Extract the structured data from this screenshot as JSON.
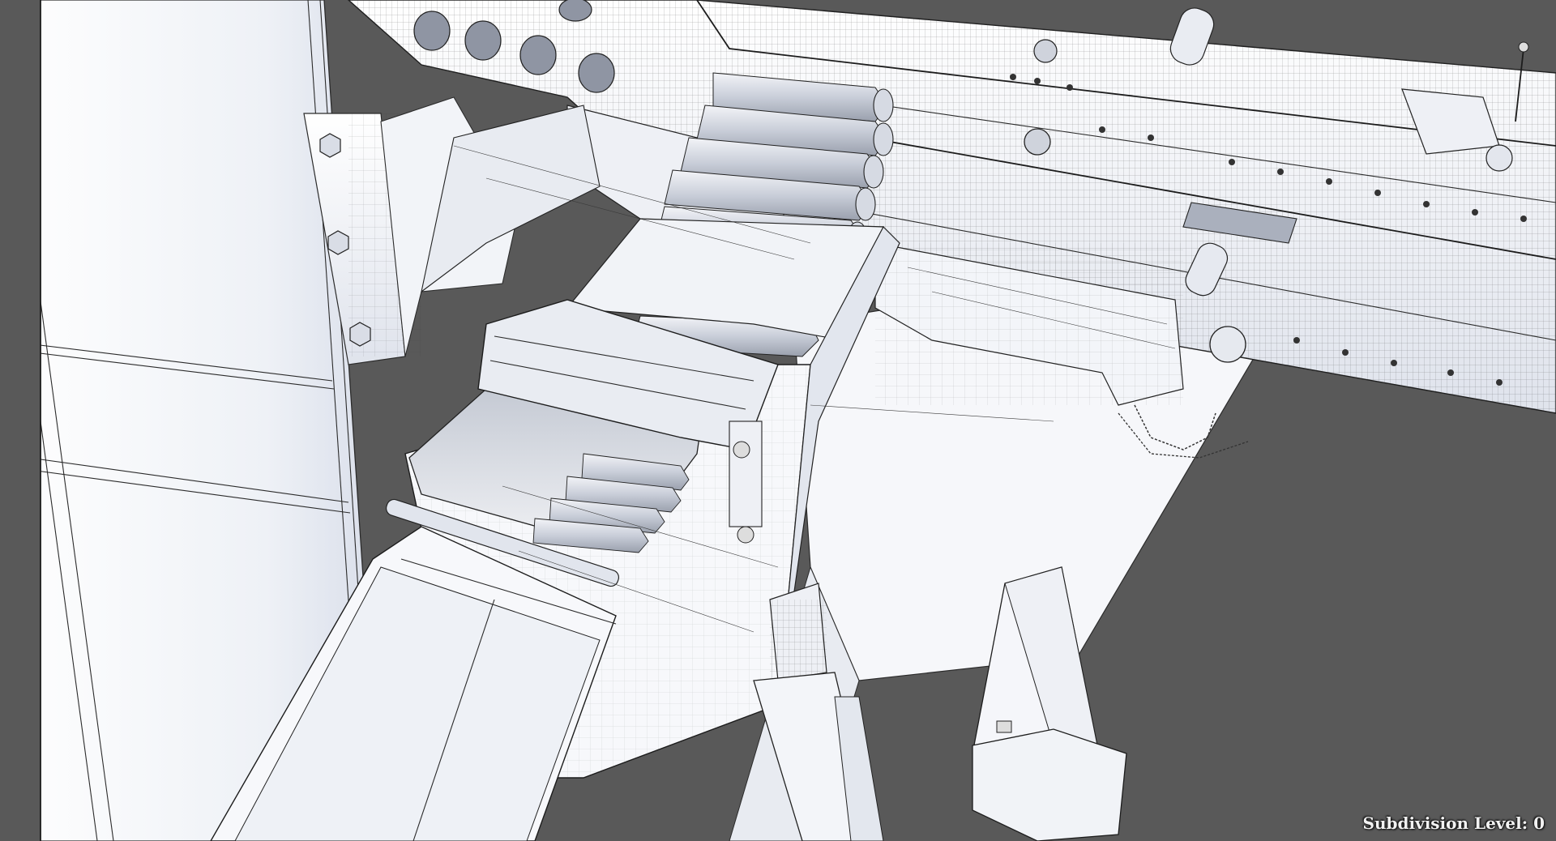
{
  "overlay": {
    "subdivision_label": "Subdivision Level: 0"
  },
  "colors": {
    "background": "#595959",
    "model_surface": "#f4f5f8",
    "wireframe": "#2b2b2b",
    "shadow": "#bfc6d6"
  }
}
